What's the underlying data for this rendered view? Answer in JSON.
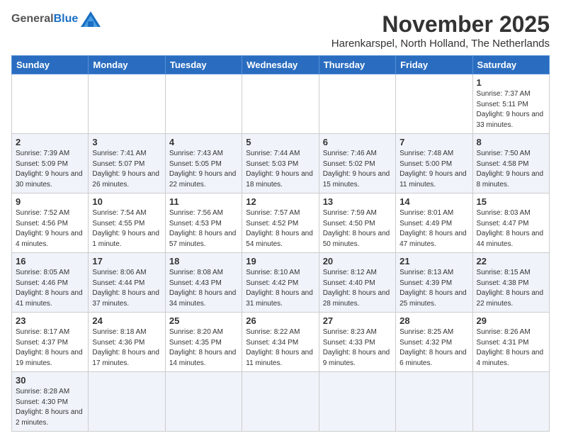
{
  "header": {
    "logo_general": "General",
    "logo_blue": "Blue",
    "month_title": "November 2025",
    "location": "Harenkarspel, North Holland, The Netherlands"
  },
  "weekdays": [
    "Sunday",
    "Monday",
    "Tuesday",
    "Wednesday",
    "Thursday",
    "Friday",
    "Saturday"
  ],
  "weeks": [
    [
      {
        "day": "",
        "info": ""
      },
      {
        "day": "",
        "info": ""
      },
      {
        "day": "",
        "info": ""
      },
      {
        "day": "",
        "info": ""
      },
      {
        "day": "",
        "info": ""
      },
      {
        "day": "",
        "info": ""
      },
      {
        "day": "1",
        "info": "Sunrise: 7:37 AM\nSunset: 5:11 PM\nDaylight: 9 hours\nand 33 minutes."
      }
    ],
    [
      {
        "day": "2",
        "info": "Sunrise: 7:39 AM\nSunset: 5:09 PM\nDaylight: 9 hours\nand 30 minutes."
      },
      {
        "day": "3",
        "info": "Sunrise: 7:41 AM\nSunset: 5:07 PM\nDaylight: 9 hours\nand 26 minutes."
      },
      {
        "day": "4",
        "info": "Sunrise: 7:43 AM\nSunset: 5:05 PM\nDaylight: 9 hours\nand 22 minutes."
      },
      {
        "day": "5",
        "info": "Sunrise: 7:44 AM\nSunset: 5:03 PM\nDaylight: 9 hours\nand 18 minutes."
      },
      {
        "day": "6",
        "info": "Sunrise: 7:46 AM\nSunset: 5:02 PM\nDaylight: 9 hours\nand 15 minutes."
      },
      {
        "day": "7",
        "info": "Sunrise: 7:48 AM\nSunset: 5:00 PM\nDaylight: 9 hours\nand 11 minutes."
      },
      {
        "day": "8",
        "info": "Sunrise: 7:50 AM\nSunset: 4:58 PM\nDaylight: 9 hours\nand 8 minutes."
      }
    ],
    [
      {
        "day": "9",
        "info": "Sunrise: 7:52 AM\nSunset: 4:56 PM\nDaylight: 9 hours\nand 4 minutes."
      },
      {
        "day": "10",
        "info": "Sunrise: 7:54 AM\nSunset: 4:55 PM\nDaylight: 9 hours\nand 1 minute."
      },
      {
        "day": "11",
        "info": "Sunrise: 7:56 AM\nSunset: 4:53 PM\nDaylight: 8 hours\nand 57 minutes."
      },
      {
        "day": "12",
        "info": "Sunrise: 7:57 AM\nSunset: 4:52 PM\nDaylight: 8 hours\nand 54 minutes."
      },
      {
        "day": "13",
        "info": "Sunrise: 7:59 AM\nSunset: 4:50 PM\nDaylight: 8 hours\nand 50 minutes."
      },
      {
        "day": "14",
        "info": "Sunrise: 8:01 AM\nSunset: 4:49 PM\nDaylight: 8 hours\nand 47 minutes."
      },
      {
        "day": "15",
        "info": "Sunrise: 8:03 AM\nSunset: 4:47 PM\nDaylight: 8 hours\nand 44 minutes."
      }
    ],
    [
      {
        "day": "16",
        "info": "Sunrise: 8:05 AM\nSunset: 4:46 PM\nDaylight: 8 hours\nand 41 minutes."
      },
      {
        "day": "17",
        "info": "Sunrise: 8:06 AM\nSunset: 4:44 PM\nDaylight: 8 hours\nand 37 minutes."
      },
      {
        "day": "18",
        "info": "Sunrise: 8:08 AM\nSunset: 4:43 PM\nDaylight: 8 hours\nand 34 minutes."
      },
      {
        "day": "19",
        "info": "Sunrise: 8:10 AM\nSunset: 4:42 PM\nDaylight: 8 hours\nand 31 minutes."
      },
      {
        "day": "20",
        "info": "Sunrise: 8:12 AM\nSunset: 4:40 PM\nDaylight: 8 hours\nand 28 minutes."
      },
      {
        "day": "21",
        "info": "Sunrise: 8:13 AM\nSunset: 4:39 PM\nDaylight: 8 hours\nand 25 minutes."
      },
      {
        "day": "22",
        "info": "Sunrise: 8:15 AM\nSunset: 4:38 PM\nDaylight: 8 hours\nand 22 minutes."
      }
    ],
    [
      {
        "day": "23",
        "info": "Sunrise: 8:17 AM\nSunset: 4:37 PM\nDaylight: 8 hours\nand 19 minutes."
      },
      {
        "day": "24",
        "info": "Sunrise: 8:18 AM\nSunset: 4:36 PM\nDaylight: 8 hours\nand 17 minutes."
      },
      {
        "day": "25",
        "info": "Sunrise: 8:20 AM\nSunset: 4:35 PM\nDaylight: 8 hours\nand 14 minutes."
      },
      {
        "day": "26",
        "info": "Sunrise: 8:22 AM\nSunset: 4:34 PM\nDaylight: 8 hours\nand 11 minutes."
      },
      {
        "day": "27",
        "info": "Sunrise: 8:23 AM\nSunset: 4:33 PM\nDaylight: 8 hours\nand 9 minutes."
      },
      {
        "day": "28",
        "info": "Sunrise: 8:25 AM\nSunset: 4:32 PM\nDaylight: 8 hours\nand 6 minutes."
      },
      {
        "day": "29",
        "info": "Sunrise: 8:26 AM\nSunset: 4:31 PM\nDaylight: 8 hours\nand 4 minutes."
      }
    ],
    [
      {
        "day": "30",
        "info": "Sunrise: 8:28 AM\nSunset: 4:30 PM\nDaylight: 8 hours\nand 2 minutes."
      },
      {
        "day": "",
        "info": ""
      },
      {
        "day": "",
        "info": ""
      },
      {
        "day": "",
        "info": ""
      },
      {
        "day": "",
        "info": ""
      },
      {
        "day": "",
        "info": ""
      },
      {
        "day": "",
        "info": ""
      }
    ]
  ]
}
